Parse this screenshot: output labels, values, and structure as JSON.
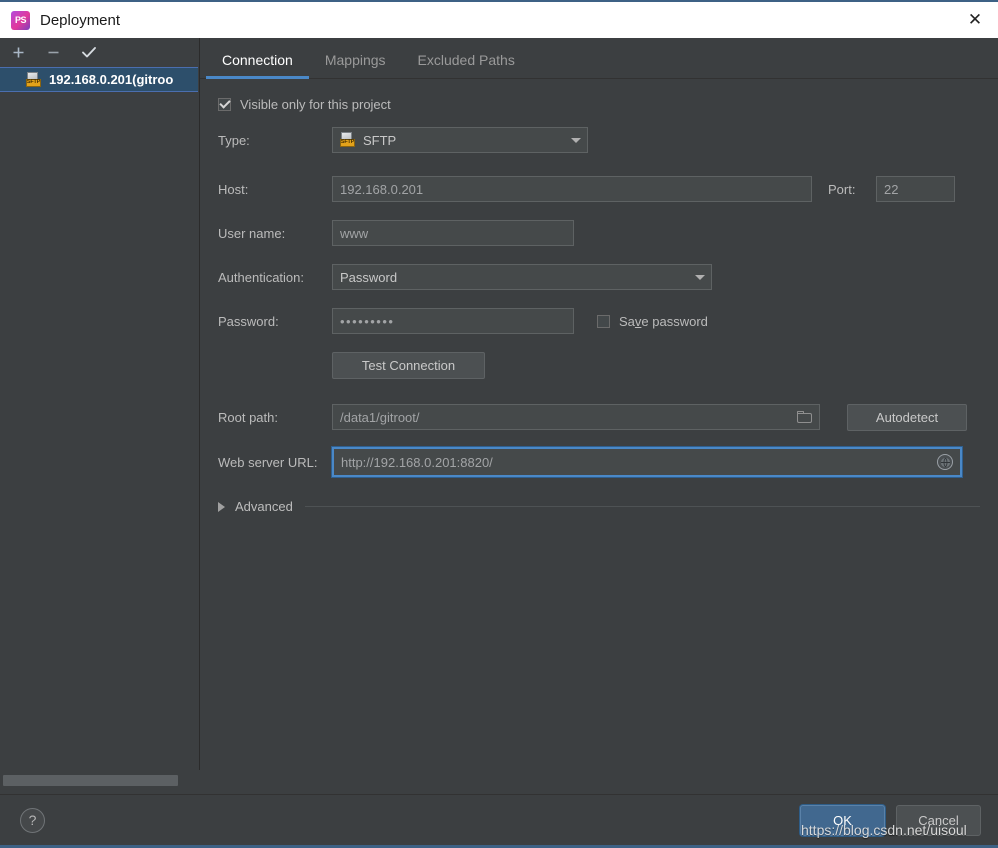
{
  "window": {
    "title": "Deployment",
    "app_icon": "phpstorm-icon",
    "close_icon": "close-icon",
    "accent_color": "#4a88c7",
    "titlebar_bg": "#ffffff",
    "dialog_bg": "#3c3f41"
  },
  "sidebar": {
    "toolbar": [
      {
        "name": "add-server-button",
        "icon": "plus-icon"
      },
      {
        "name": "remove-server-button",
        "icon": "minus-icon"
      },
      {
        "name": "set-default-server-button",
        "icon": "check-icon"
      }
    ],
    "items": [
      {
        "label": "192.168.0.201(gitroo",
        "icon": "sftp-icon",
        "selected": true
      }
    ],
    "scrollbar": "horizontal-scrollbar"
  },
  "tabs": [
    {
      "label": "Connection",
      "active": true
    },
    {
      "label": "Mappings",
      "active": false
    },
    {
      "label": "Excluded Paths",
      "active": false
    }
  ],
  "form": {
    "visible_only": {
      "label": "Visible only for this project",
      "checked": true
    },
    "type": {
      "label": "Type:",
      "value": "SFTP",
      "icon": "sftp-icon",
      "caret": "chevron-down-icon"
    },
    "host": {
      "label": "Host:",
      "value": "192.168.0.201"
    },
    "port": {
      "label": "Port:",
      "value": "22"
    },
    "username": {
      "label": "User name:",
      "value": "www"
    },
    "authentication": {
      "label": "Authentication:",
      "value": "Password",
      "caret": "chevron-down-icon"
    },
    "password": {
      "label": "Password:",
      "value": "•••••••••",
      "save_label_pre": "Sa",
      "save_label_mnemonic": "v",
      "save_label_post": "e password",
      "save_checked": false
    },
    "test_connection": {
      "label": "Test Connection"
    },
    "root_path": {
      "label": "Root path:",
      "value": "/data1/gitroot/",
      "browse_icon": "folder-icon"
    },
    "autodetect": {
      "label": "Autodetect"
    },
    "web_server_url": {
      "label": "Web server URL:",
      "value": "http://192.168.0.201:8820/",
      "focused": true,
      "open_icon": "globe-icon"
    },
    "advanced": {
      "label": "Advanced",
      "expanded": false,
      "caret": "chevron-right-icon"
    }
  },
  "footer": {
    "help_icon": "question-mark-icon",
    "ok_label": "OK",
    "cancel_label": "Cancel"
  },
  "watermark": "https://blog.csdn.net/uisoul"
}
